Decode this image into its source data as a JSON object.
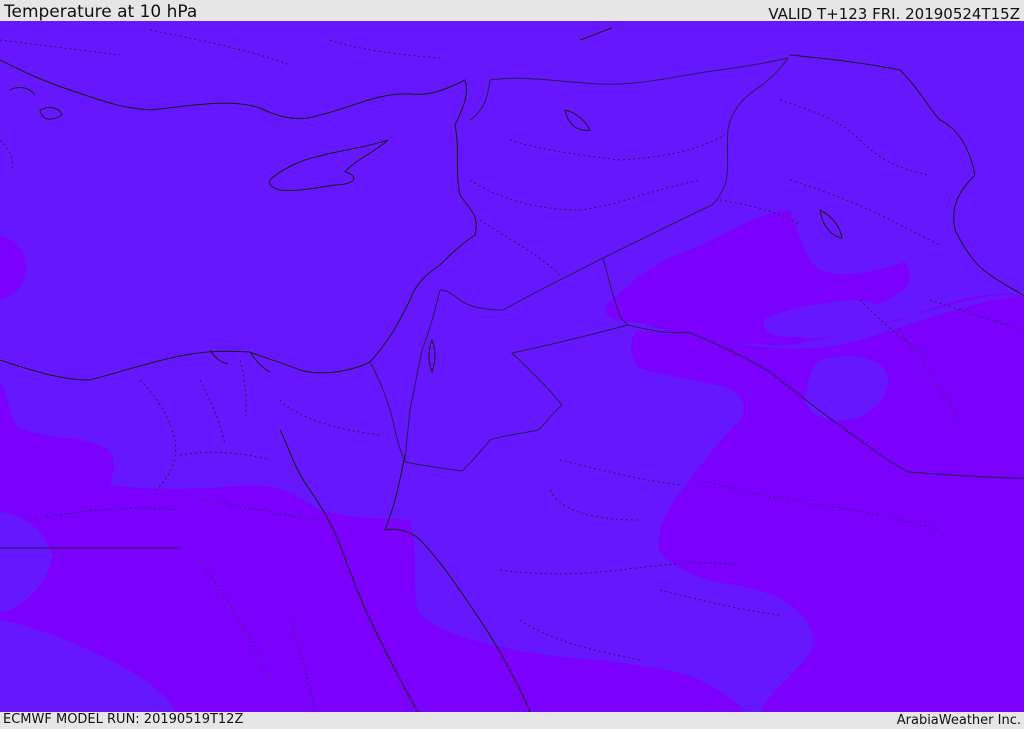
{
  "header": {
    "title": "Temperature at 10 hPa",
    "valid": "VALID T+123 FRI. 20190524T15Z"
  },
  "footer": {
    "model_run": "ECMWF MODEL RUN: 20190519T12Z",
    "credit": "ArabiaWeather Inc."
  },
  "colors": {
    "band_cooler": "#6617fe",
    "band_warmer": "#7b00fd",
    "coastline": "#1a1a1a",
    "border": "#2a1a55",
    "bar_background": "#e6e6e6"
  },
  "map": {
    "icons": [
      "coastline",
      "country-border",
      "province-border"
    ]
  }
}
